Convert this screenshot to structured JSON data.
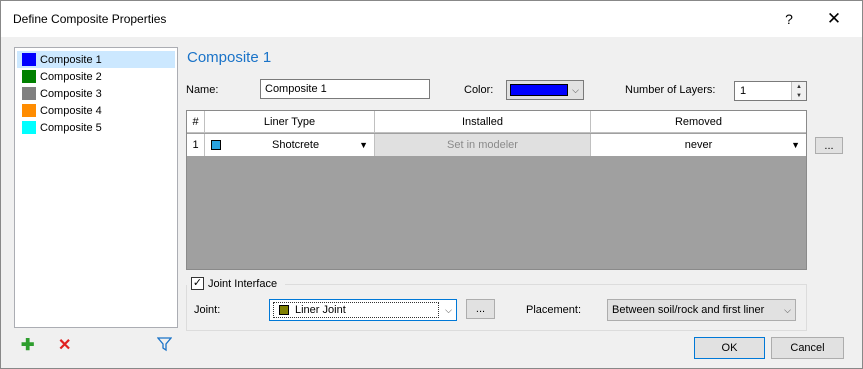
{
  "window": {
    "title": "Define Composite Properties",
    "help_glyph": "?",
    "close_glyph": "✕"
  },
  "composites": [
    {
      "label": "Composite 1",
      "color": "#0000ff"
    },
    {
      "label": "Composite 2",
      "color": "#008000"
    },
    {
      "label": "Composite 3",
      "color": "#808080"
    },
    {
      "label": "Composite 4",
      "color": "#ff8c00"
    },
    {
      "label": "Composite 5",
      "color": "#00ffff"
    }
  ],
  "list_tools": {
    "add_glyph": "✚",
    "delete_glyph": "✕",
    "filter_icon": "filter-icon"
  },
  "heading": "Composite 1",
  "form": {
    "name_label": "Name:",
    "name_value": "Composite 1",
    "color_label": "Color:",
    "color_value": "#0000ff",
    "layers_label": "Number of Layers:",
    "layers_value": "1"
  },
  "grid": {
    "headers": [
      "#",
      "Liner Type",
      "Installed",
      "Removed"
    ],
    "rows": [
      {
        "num": "1",
        "liner_type": "Shotcrete",
        "liner_color": "#29a3e0",
        "installed": "Set in modeler",
        "removed": "never"
      }
    ],
    "more_button": "..."
  },
  "joint": {
    "checkbox_label": "Joint Interface",
    "checked": "✓",
    "joint_label": "Joint:",
    "joint_value": "Liner Joint",
    "joint_color": "#808000",
    "joint_more": "...",
    "placement_label": "Placement:",
    "placement_value": "Between soil/rock and first liner"
  },
  "buttons": {
    "ok": "OK",
    "cancel": "Cancel"
  }
}
